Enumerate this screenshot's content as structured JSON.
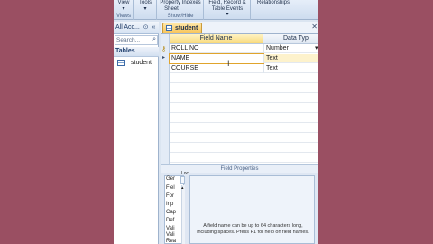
{
  "ribbon": {
    "groups": [
      {
        "commands": [
          "View"
        ],
        "caption": "Views"
      },
      {
        "commands": [
          "Tools"
        ],
        "caption": ""
      },
      {
        "commands": [
          "Property Indexes",
          "Sheet"
        ],
        "caption": "Show/Hide"
      },
      {
        "commands": [
          "Field, Record &",
          "Table Events"
        ],
        "caption": ""
      },
      {
        "commands": [
          "Relationships"
        ],
        "caption": ""
      }
    ]
  },
  "nav": {
    "title": "All Acc...",
    "search_placeholder": "Search...",
    "group_label": "Tables",
    "items": [
      {
        "label": "student"
      }
    ]
  },
  "document": {
    "tab_label": "student",
    "columns": [
      "Field Name",
      "Data Typ"
    ],
    "rows": [
      {
        "field": "ROLL NO",
        "type": "Number",
        "primary_key": true
      },
      {
        "field": "NAME",
        "type": "Text",
        "selected": true
      },
      {
        "field": "COURSE",
        "type": "Text"
      }
    ],
    "field_properties_label": "Field Properties",
    "property_tab_labels": [
      "Ger",
      "Loc"
    ],
    "property_items": [
      "Fiel",
      "For",
      "Inp",
      "Cap",
      "Def",
      "Vali",
      "Vali",
      "Rea"
    ],
    "help_text": "A field name can be up to 64 characters long, including spaces. Press F1 for help on field names."
  }
}
